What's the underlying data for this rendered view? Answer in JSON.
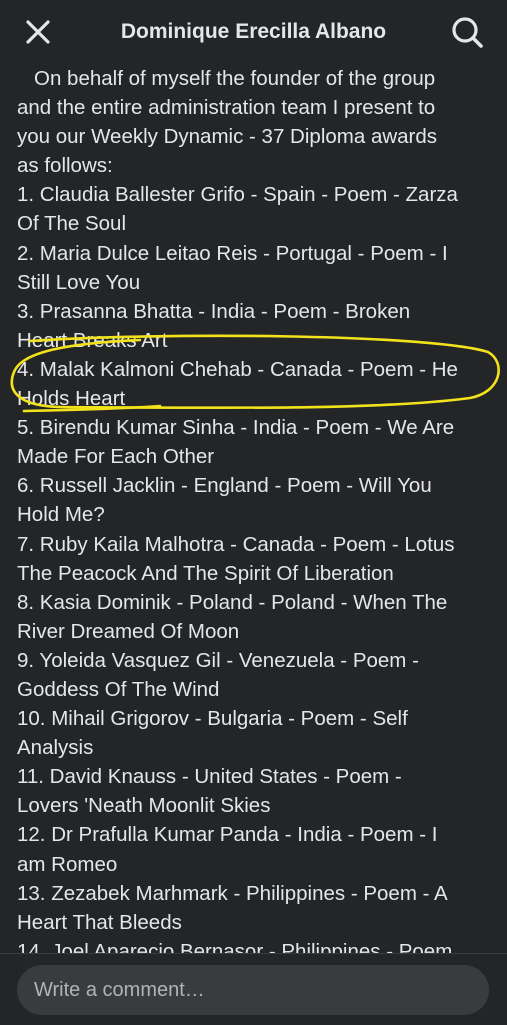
{
  "header": {
    "title": "Dominique Erecilla Albano",
    "close_icon": "close-icon",
    "search_icon": "search-icon"
  },
  "post": {
    "lines": [
      "On behalf of myself the founder of the group",
      "and the entire administration team I present to",
      "you our Weekly Dynamic - 37 Diploma awards",
      "as follows:",
      "1. Claudia Ballester Grifo - Spain - Poem - Zarza",
      "Of The Soul",
      "2. Maria Dulce Leitao Reis - Portugal - Poem - I",
      "Still Love You",
      "3. Prasanna Bhatta - India - Poem - Broken",
      "Heart Breaks Art",
      "4. Malak Kalmoni Chehab - Canada - Poem - He",
      "Holds Heart",
      "5. Birendu Kumar Sinha - India - Poem - We Are",
      "Made For Each Other",
      "6. Russell Jacklin - England - Poem - Will You",
      "Hold Me?",
      "7. Ruby Kaila Malhotra - Canada - Poem - Lotus",
      "The Peacock And The Spirit Of Liberation",
      "8. Kasia Dominik - Poland - Poland - When The",
      "River Dreamed Of Moon",
      "9. Yoleida Vasquez Gil - Venezuela - Poem -",
      "Goddess Of The Wind",
      "10. Mihail Grigorov - Bulgaria - Poem - Self",
      "Analysis",
      "11. David Knauss - United States - Poem -",
      "Lovers 'Neath Moonlit Skies",
      "12. Dr Prafulla Kumar Panda - India - Poem - I",
      "am Romeo",
      "13. Zezabek Marhmark - Philippines - Poem - A",
      "Heart That Bleeds",
      "14. Joel Aparecio Bernasor - Philippines - Poem"
    ],
    "highlight_color": "#f2e21b"
  },
  "comment": {
    "placeholder": "Write a comment…"
  },
  "colors": {
    "background": "#242526",
    "text": "#e4e6eb",
    "input_bg": "#3a3b3c",
    "placeholder": "#b0b3b8"
  }
}
